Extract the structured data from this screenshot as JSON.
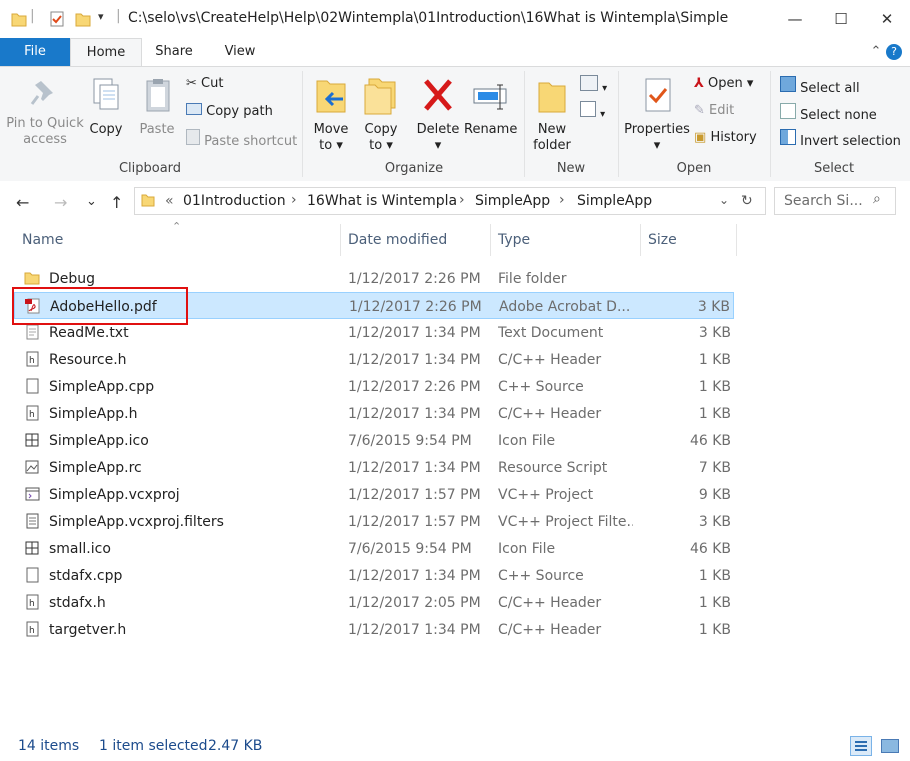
{
  "window": {
    "title": "C:\\selo\\vs\\CreateHelp\\Help\\02Wintempla\\01Introduction\\16What is Wintempla\\SimpleApp\\SimpleApp",
    "minimize": "—",
    "maximize": "☐",
    "close": "✕"
  },
  "ribbon_tabs": {
    "file": "File",
    "home": "Home",
    "share": "Share",
    "view": "View"
  },
  "ribbon": {
    "clipboard": {
      "label": "Clipboard",
      "pin_line1": "Pin to Quick",
      "pin_line2": "access",
      "copy": "Copy",
      "paste": "Paste",
      "cut": "Cut",
      "copy_path": "Copy path",
      "paste_shortcut": "Paste shortcut"
    },
    "organize": {
      "label": "Organize",
      "move_line1": "Move",
      "move_line2": "to ▾",
      "copy_line1": "Copy",
      "copy_line2": "to ▾",
      "delete": "Delete",
      "delete_arrow": "▾",
      "rename": "Rename"
    },
    "new": {
      "label": "New",
      "folder_line1": "New",
      "folder_line2": "folder"
    },
    "open": {
      "label": "Open",
      "properties": "Properties",
      "properties_arrow": "▾",
      "open": "Open ▾",
      "edit": "Edit",
      "history": "History"
    },
    "select": {
      "label": "Select",
      "select_all": "Select all",
      "select_none": "Select none",
      "invert": "Invert selection"
    },
    "collapse_icon": "⌃",
    "help_icon": "?"
  },
  "nav": {
    "back": "←",
    "forward": "→",
    "recent": "⌄",
    "up": "↑",
    "breadcrumb": [
      "«",
      "01Introduction",
      "16What is Wintempla",
      "SimpleApp",
      "SimpleApp"
    ],
    "crumb_sep": "›",
    "dropdown": "⌄",
    "refresh": "↻",
    "search_placeholder": "Search Si...",
    "search_icon": "⌕"
  },
  "columns": {
    "name": "Name",
    "date": "Date modified",
    "type": "Type",
    "size": "Size",
    "sort": "⌃"
  },
  "files": [
    {
      "name": "Debug",
      "date": "1/12/2017 2:26 PM",
      "type": "File folder",
      "size": "",
      "icon": "folder-icon"
    },
    {
      "name": "AdobeHello.pdf",
      "date": "1/12/2017 2:26 PM",
      "type": "Adobe Acrobat D...",
      "size": "3 KB",
      "icon": "pdf-icon",
      "selected": true
    },
    {
      "name": "ReadMe.txt",
      "date": "1/12/2017 1:34 PM",
      "type": "Text Document",
      "size": "3 KB",
      "icon": "text-file-icon"
    },
    {
      "name": "Resource.h",
      "date": "1/12/2017 1:34 PM",
      "type": "C/C++ Header",
      "size": "1 KB",
      "icon": "header-file-icon"
    },
    {
      "name": "SimpleApp.cpp",
      "date": "1/12/2017 2:26 PM",
      "type": "C++ Source",
      "size": "1 KB",
      "icon": "source-file-icon"
    },
    {
      "name": "SimpleApp.h",
      "date": "1/12/2017 1:34 PM",
      "type": "C/C++ Header",
      "size": "1 KB",
      "icon": "header-file-icon"
    },
    {
      "name": "SimpleApp.ico",
      "date": "7/6/2015 9:54 PM",
      "type": "Icon File",
      "size": "46 KB",
      "icon": "ico-file-icon"
    },
    {
      "name": "SimpleApp.rc",
      "date": "1/12/2017 1:34 PM",
      "type": "Resource Script",
      "size": "7 KB",
      "icon": "rc-file-icon"
    },
    {
      "name": "SimpleApp.vcxproj",
      "date": "1/12/2017 1:57 PM",
      "type": "VC++ Project",
      "size": "9 KB",
      "icon": "project-file-icon"
    },
    {
      "name": "SimpleApp.vcxproj.filters",
      "date": "1/12/2017 1:57 PM",
      "type": "VC++ Project Filte...",
      "size": "3 KB",
      "icon": "filters-file-icon"
    },
    {
      "name": "small.ico",
      "date": "7/6/2015 9:54 PM",
      "type": "Icon File",
      "size": "46 KB",
      "icon": "ico-file-icon"
    },
    {
      "name": "stdafx.cpp",
      "date": "1/12/2017 1:34 PM",
      "type": "C++ Source",
      "size": "1 KB",
      "icon": "source-file-icon"
    },
    {
      "name": "stdafx.h",
      "date": "1/12/2017 2:05 PM",
      "type": "C/C++ Header",
      "size": "1 KB",
      "icon": "header-file-icon"
    },
    {
      "name": "targetver.h",
      "date": "1/12/2017 1:34 PM",
      "type": "C/C++ Header",
      "size": "1 KB",
      "icon": "header-file-icon"
    }
  ],
  "status": {
    "count": "14 items",
    "selected": "1 item selected",
    "size": "2.47 KB"
  },
  "colors": {
    "accent": "#1979ca",
    "selection": "#cce8ff",
    "highlight": "#e01010"
  }
}
